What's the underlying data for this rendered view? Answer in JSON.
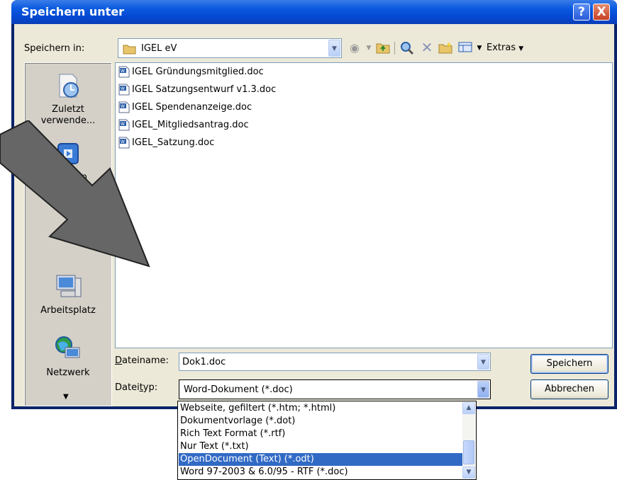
{
  "dialog": {
    "title": "Speichern unter",
    "help_label": "?",
    "close_label": "X"
  },
  "location": {
    "label": "Speichern in:",
    "folder": "IGEL eV"
  },
  "toolbar": {
    "extras_label": "Extras",
    "icons": [
      "back-icon",
      "up-folder-icon",
      "search-web-icon",
      "delete-icon",
      "new-folder-icon",
      "views-icon"
    ]
  },
  "places": [
    {
      "label": "Zuletzt verwende...",
      "icon": "recent-icon"
    },
    {
      "label": "Desktop",
      "icon": "desktop-icon"
    },
    {
      "label": "Arbeitsplatz",
      "icon": "computer-icon"
    },
    {
      "label": "Netzwerk",
      "icon": "network-icon"
    }
  ],
  "files": [
    "IGEL Gründungsmitglied.doc",
    "IGEL Satzungsentwurf v1.3.doc",
    "IGEL Spendenanzeige.doc",
    "IGEL_Mitgliedsantrag.doc",
    "IGEL_Satzung.doc"
  ],
  "filename": {
    "label": "Dateiname:",
    "value": "Dok1.doc"
  },
  "filetype": {
    "label": "Dateityp:",
    "value": "Word-Dokument (*.doc)",
    "options": [
      "Webseite, gefiltert (*.htm; *.html)",
      "Dokumentvorlage (*.dot)",
      "Rich Text Format (*.rtf)",
      "Nur Text (*.txt)",
      "OpenDocument (Text) (*.odt)",
      "Word 97-2003 & 6.0/95 - RTF (*.doc)"
    ],
    "selected_index": 4
  },
  "buttons": {
    "save": "Speichern",
    "cancel": "Abbrechen"
  },
  "colors": {
    "title_bar": "#0548d2",
    "selection": "#316ac5",
    "annotation_arrow": "#666666"
  }
}
